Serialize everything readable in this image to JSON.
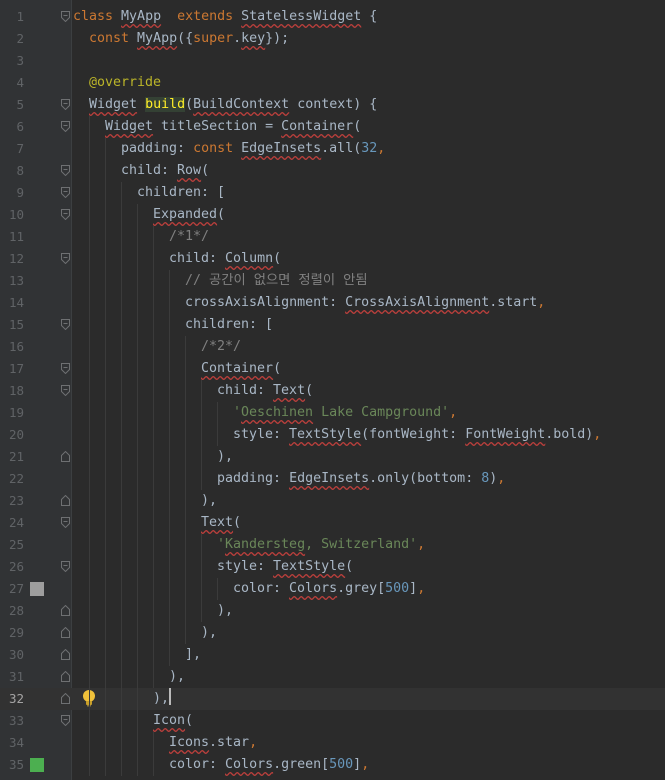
{
  "editor": {
    "current_line": 32,
    "colors": {
      "background": "#2b2b2b",
      "gutter": "#313335",
      "current_line": "#323232",
      "keyword": "#cc7832",
      "number": "#6897bb",
      "string": "#6a8759",
      "comment": "#808080",
      "annotation": "#bbb529",
      "highlight_fg": "#ffef28",
      "error_squiggle": "#bc3f3c"
    },
    "gutter_colors": {
      "27": "#9e9e9e",
      "35": "#4caf50"
    },
    "lines": [
      {
        "n": 1,
        "indent": 0,
        "fold": "open",
        "tokens": [
          [
            "kw",
            "class "
          ],
          [
            "sq",
            "MyApp"
          ],
          [
            "",
            "  "
          ],
          [
            "kw",
            "extends "
          ],
          [
            "sq",
            "StatelessWidget"
          ],
          [
            "",
            " {"
          ]
        ]
      },
      {
        "n": 2,
        "indent": 1,
        "tokens": [
          [
            "kw",
            "const "
          ],
          [
            "sq",
            "MyApp"
          ],
          [
            "",
            "({"
          ],
          [
            "kw",
            "super"
          ],
          [
            "",
            "."
          ],
          [
            "sq",
            "key"
          ],
          [
            "",
            "});"
          ]
        ]
      },
      {
        "n": 3,
        "indent": 0,
        "tokens": []
      },
      {
        "n": 4,
        "indent": 1,
        "tokens": [
          [
            "ann",
            "@override"
          ]
        ]
      },
      {
        "n": 5,
        "indent": 1,
        "fold": "open",
        "tokens": [
          [
            "sq",
            "Widget"
          ],
          [
            "",
            " "
          ],
          [
            "hl",
            "build"
          ],
          [
            "",
            "("
          ],
          [
            "sq",
            "BuildContext"
          ],
          [
            "",
            " context) {"
          ]
        ]
      },
      {
        "n": 6,
        "indent": 2,
        "fold": "open",
        "tokens": [
          [
            "sq",
            "Widget"
          ],
          [
            "",
            " titleSection = "
          ],
          [
            "sq",
            "Container"
          ],
          [
            "",
            "("
          ]
        ]
      },
      {
        "n": 7,
        "indent": 3,
        "tokens": [
          [
            "",
            "padding: "
          ],
          [
            "kw",
            "const "
          ],
          [
            "sq",
            "EdgeInsets"
          ],
          [
            "",
            ".all("
          ],
          [
            "num",
            "32"
          ],
          [
            "kw",
            ","
          ]
        ]
      },
      {
        "n": 8,
        "indent": 3,
        "fold": "open",
        "tokens": [
          [
            "",
            "child: "
          ],
          [
            "sq",
            "Row"
          ],
          [
            "",
            "("
          ]
        ]
      },
      {
        "n": 9,
        "indent": 4,
        "fold": "open",
        "tokens": [
          [
            "",
            "children: ["
          ]
        ]
      },
      {
        "n": 10,
        "indent": 5,
        "fold": "open",
        "tokens": [
          [
            "sq",
            "Expanded"
          ],
          [
            "",
            "("
          ]
        ]
      },
      {
        "n": 11,
        "indent": 6,
        "tokens": [
          [
            "cmt",
            "/*1*/"
          ]
        ]
      },
      {
        "n": 12,
        "indent": 6,
        "fold": "open",
        "tokens": [
          [
            "",
            "child: "
          ],
          [
            "sq",
            "Column"
          ],
          [
            "",
            "("
          ]
        ]
      },
      {
        "n": 13,
        "indent": 7,
        "tokens": [
          [
            "cmt",
            "// 공간이 없으면 정렬이 안됨"
          ]
        ]
      },
      {
        "n": 14,
        "indent": 7,
        "tokens": [
          [
            "",
            "crossAxisAlignment: "
          ],
          [
            "sq",
            "CrossAxisAlignment"
          ],
          [
            "",
            ".start"
          ],
          [
            "kw",
            ","
          ]
        ]
      },
      {
        "n": 15,
        "indent": 7,
        "fold": "open",
        "tokens": [
          [
            "",
            "children: ["
          ]
        ]
      },
      {
        "n": 16,
        "indent": 8,
        "tokens": [
          [
            "cmt",
            "/*2*/"
          ]
        ]
      },
      {
        "n": 17,
        "indent": 8,
        "fold": "open",
        "tokens": [
          [
            "sq",
            "Container"
          ],
          [
            "",
            "("
          ]
        ]
      },
      {
        "n": 18,
        "indent": 9,
        "fold": "open",
        "tokens": [
          [
            "",
            "child: "
          ],
          [
            "sq",
            "Text"
          ],
          [
            "",
            "("
          ]
        ]
      },
      {
        "n": 19,
        "indent": 10,
        "tokens": [
          [
            "str",
            "'"
          ],
          [
            "str sq",
            "Oeschinen"
          ],
          [
            "str",
            " Lake Campground'"
          ],
          [
            "kw",
            ","
          ]
        ]
      },
      {
        "n": 20,
        "indent": 10,
        "tokens": [
          [
            "",
            "style: "
          ],
          [
            "sq",
            "TextStyle"
          ],
          [
            "",
            "(fontWeight: "
          ],
          [
            "sq",
            "FontWeight"
          ],
          [
            "",
            ".bold)"
          ],
          [
            "kw",
            ","
          ]
        ]
      },
      {
        "n": 21,
        "indent": 9,
        "fold": "close",
        "tokens": [
          [
            "",
            "),"
          ]
        ]
      },
      {
        "n": 22,
        "indent": 9,
        "tokens": [
          [
            "",
            "padding: "
          ],
          [
            "sq",
            "EdgeInsets"
          ],
          [
            "",
            ".only(bottom: "
          ],
          [
            "num",
            "8"
          ],
          [
            "",
            ")"
          ],
          [
            "kw",
            ","
          ]
        ]
      },
      {
        "n": 23,
        "indent": 8,
        "fold": "close",
        "tokens": [
          [
            "",
            "),"
          ]
        ]
      },
      {
        "n": 24,
        "indent": 8,
        "fold": "open",
        "tokens": [
          [
            "sq",
            "Text"
          ],
          [
            "",
            "("
          ]
        ]
      },
      {
        "n": 25,
        "indent": 9,
        "tokens": [
          [
            "str",
            "'"
          ],
          [
            "str sq",
            "Kandersteg"
          ],
          [
            "str",
            ", Switzerland'"
          ],
          [
            "kw",
            ","
          ]
        ]
      },
      {
        "n": 26,
        "indent": 9,
        "fold": "open",
        "tokens": [
          [
            "",
            "style: "
          ],
          [
            "sq",
            "TextStyle"
          ],
          [
            "",
            "("
          ]
        ]
      },
      {
        "n": 27,
        "indent": 10,
        "gutter_mark": "27",
        "tokens": [
          [
            "",
            "color: "
          ],
          [
            "sq",
            "Colors"
          ],
          [
            "",
            ".grey["
          ],
          [
            "num",
            "500"
          ],
          [
            "",
            "]"
          ],
          [
            "kw",
            ","
          ]
        ]
      },
      {
        "n": 28,
        "indent": 9,
        "fold": "close",
        "tokens": [
          [
            "",
            "),"
          ]
        ]
      },
      {
        "n": 29,
        "indent": 8,
        "fold": "close",
        "tokens": [
          [
            "",
            "),"
          ]
        ]
      },
      {
        "n": 30,
        "indent": 7,
        "fold": "close",
        "tokens": [
          [
            "",
            "],"
          ]
        ]
      },
      {
        "n": 31,
        "indent": 6,
        "fold": "close",
        "tokens": [
          [
            "",
            "),"
          ]
        ]
      },
      {
        "n": 32,
        "indent": 5,
        "fold": "close",
        "bulb": true,
        "caret": true,
        "tokens": [
          [
            "",
            "),"
          ]
        ]
      },
      {
        "n": 33,
        "indent": 5,
        "fold": "open",
        "tokens": [
          [
            "sq",
            "Icon"
          ],
          [
            "",
            "("
          ]
        ]
      },
      {
        "n": 34,
        "indent": 6,
        "tokens": [
          [
            "sq",
            "Icons"
          ],
          [
            "",
            ".star"
          ],
          [
            "kw",
            ","
          ]
        ]
      },
      {
        "n": 35,
        "indent": 6,
        "gutter_mark": "35",
        "tokens": [
          [
            "",
            "color: "
          ],
          [
            "sq",
            "Colors"
          ],
          [
            "",
            ".green["
          ],
          [
            "num",
            "500"
          ],
          [
            "",
            "]"
          ],
          [
            "kw",
            ","
          ]
        ]
      }
    ]
  }
}
